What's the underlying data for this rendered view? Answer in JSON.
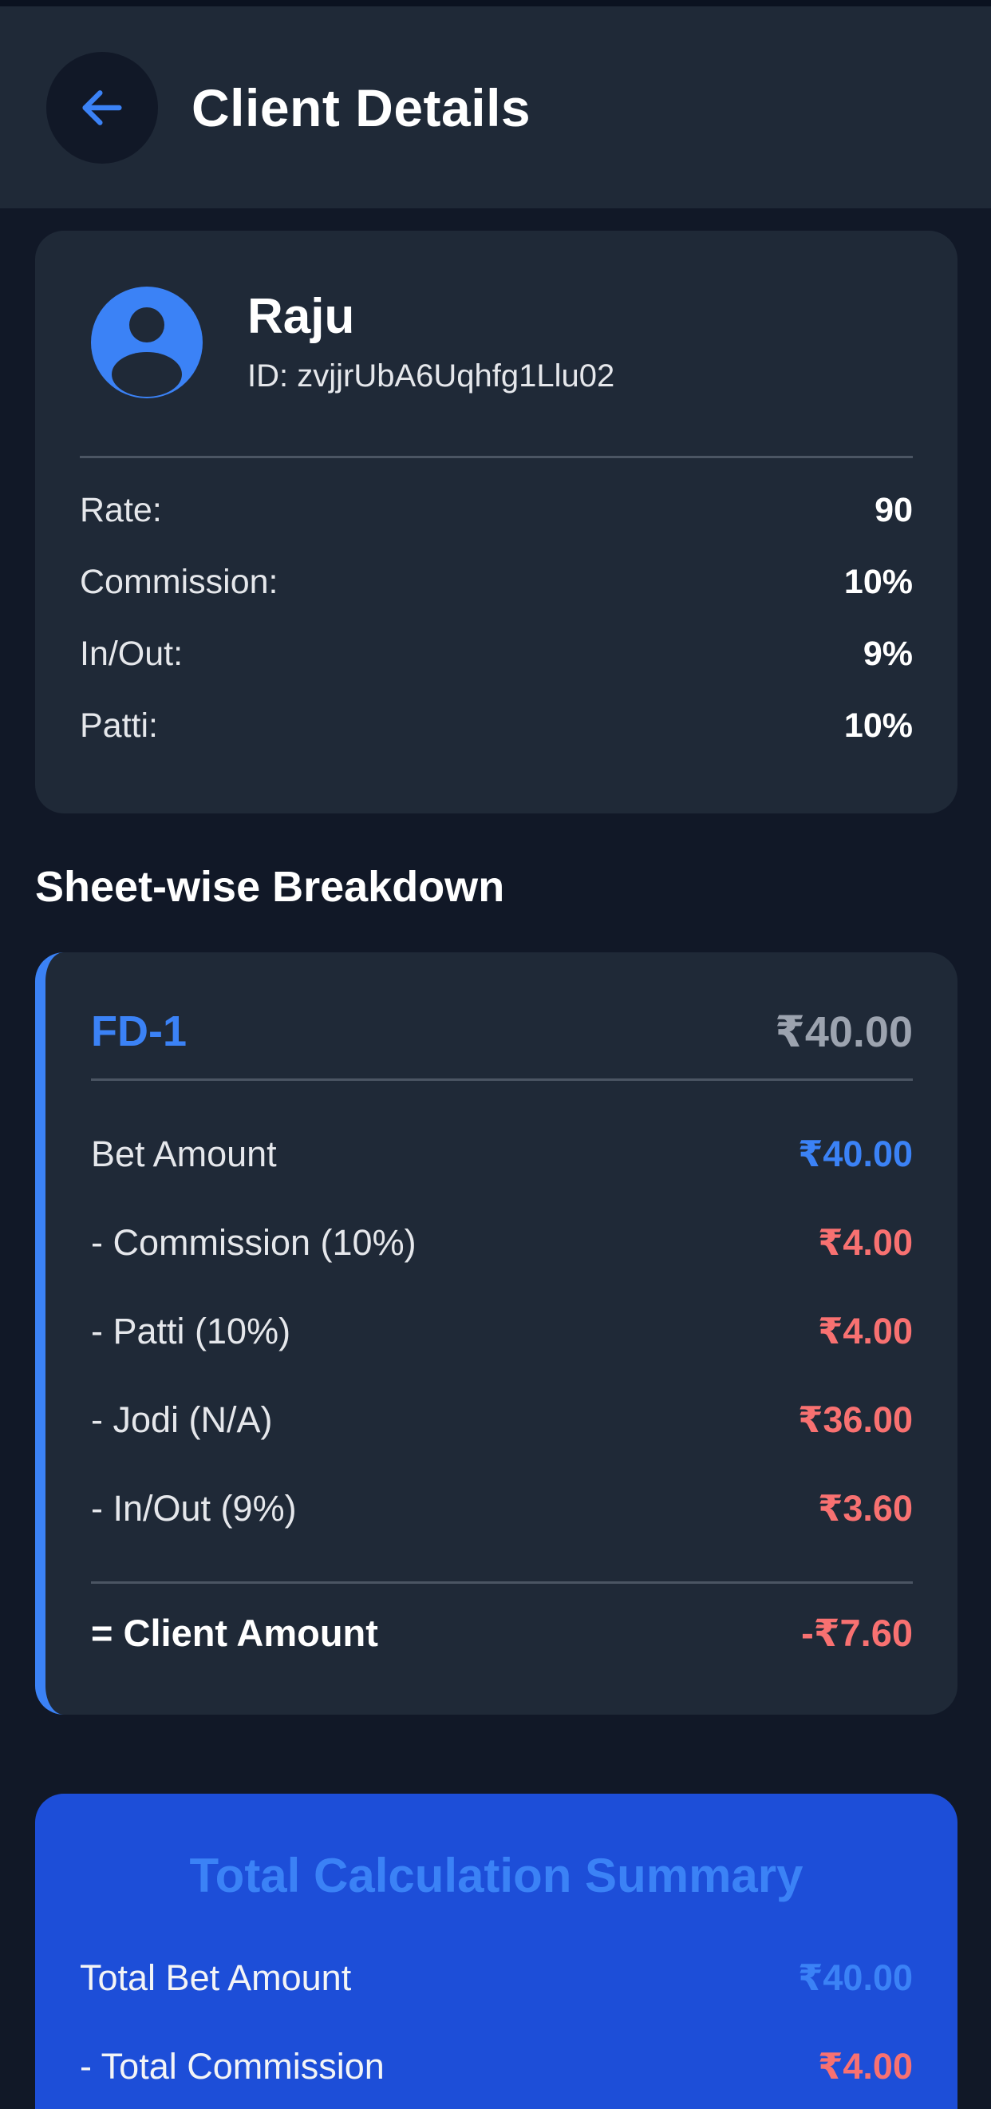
{
  "header": {
    "title": "Client Details",
    "back_icon": "arrow-left-icon"
  },
  "client": {
    "name": "Raju",
    "id_text": "ID: zvjjrUbA6Uqhfg1Llu02",
    "avatar_icon": "user-avatar-icon",
    "details": [
      {
        "label": "Rate:",
        "value": "90"
      },
      {
        "label": "Commission:",
        "value": "10%"
      },
      {
        "label": "In/Out:",
        "value": "9%"
      },
      {
        "label": "Patti:",
        "value": "10%"
      }
    ]
  },
  "breakdown": {
    "section_title": "Sheet-wise Breakdown",
    "sheets": [
      {
        "name": "FD-1",
        "total": "₹40.00",
        "rows": [
          {
            "label": "Bet Amount",
            "value": "₹40.00",
            "color": "#3b82f6"
          },
          {
            "label": "- Commission (10%)",
            "value": "₹4.00",
            "color": "#f87171"
          },
          {
            "label": "- Patti (10%)",
            "value": "₹4.00",
            "color": "#f87171"
          },
          {
            "label": "- Jodi (N/A)",
            "value": "₹36.00",
            "color": "#f87171"
          },
          {
            "label": "- In/Out (9%)",
            "value": "₹3.60",
            "color": "#f87171"
          }
        ],
        "client_amount_label": "= Client Amount",
        "client_amount_value": "-₹7.60"
      }
    ]
  },
  "summary": {
    "title": "Total Calculation Summary",
    "rows": [
      {
        "label": "Total Bet Amount",
        "value": "₹40.00"
      },
      {
        "label": "- Total Commission",
        "value": "₹4.00"
      }
    ]
  },
  "colors": {
    "background": "#111827",
    "card": "#1f2937",
    "accent": "#3b82f6",
    "negative": "#f87171",
    "summary_bg": "#1d4ed8"
  }
}
